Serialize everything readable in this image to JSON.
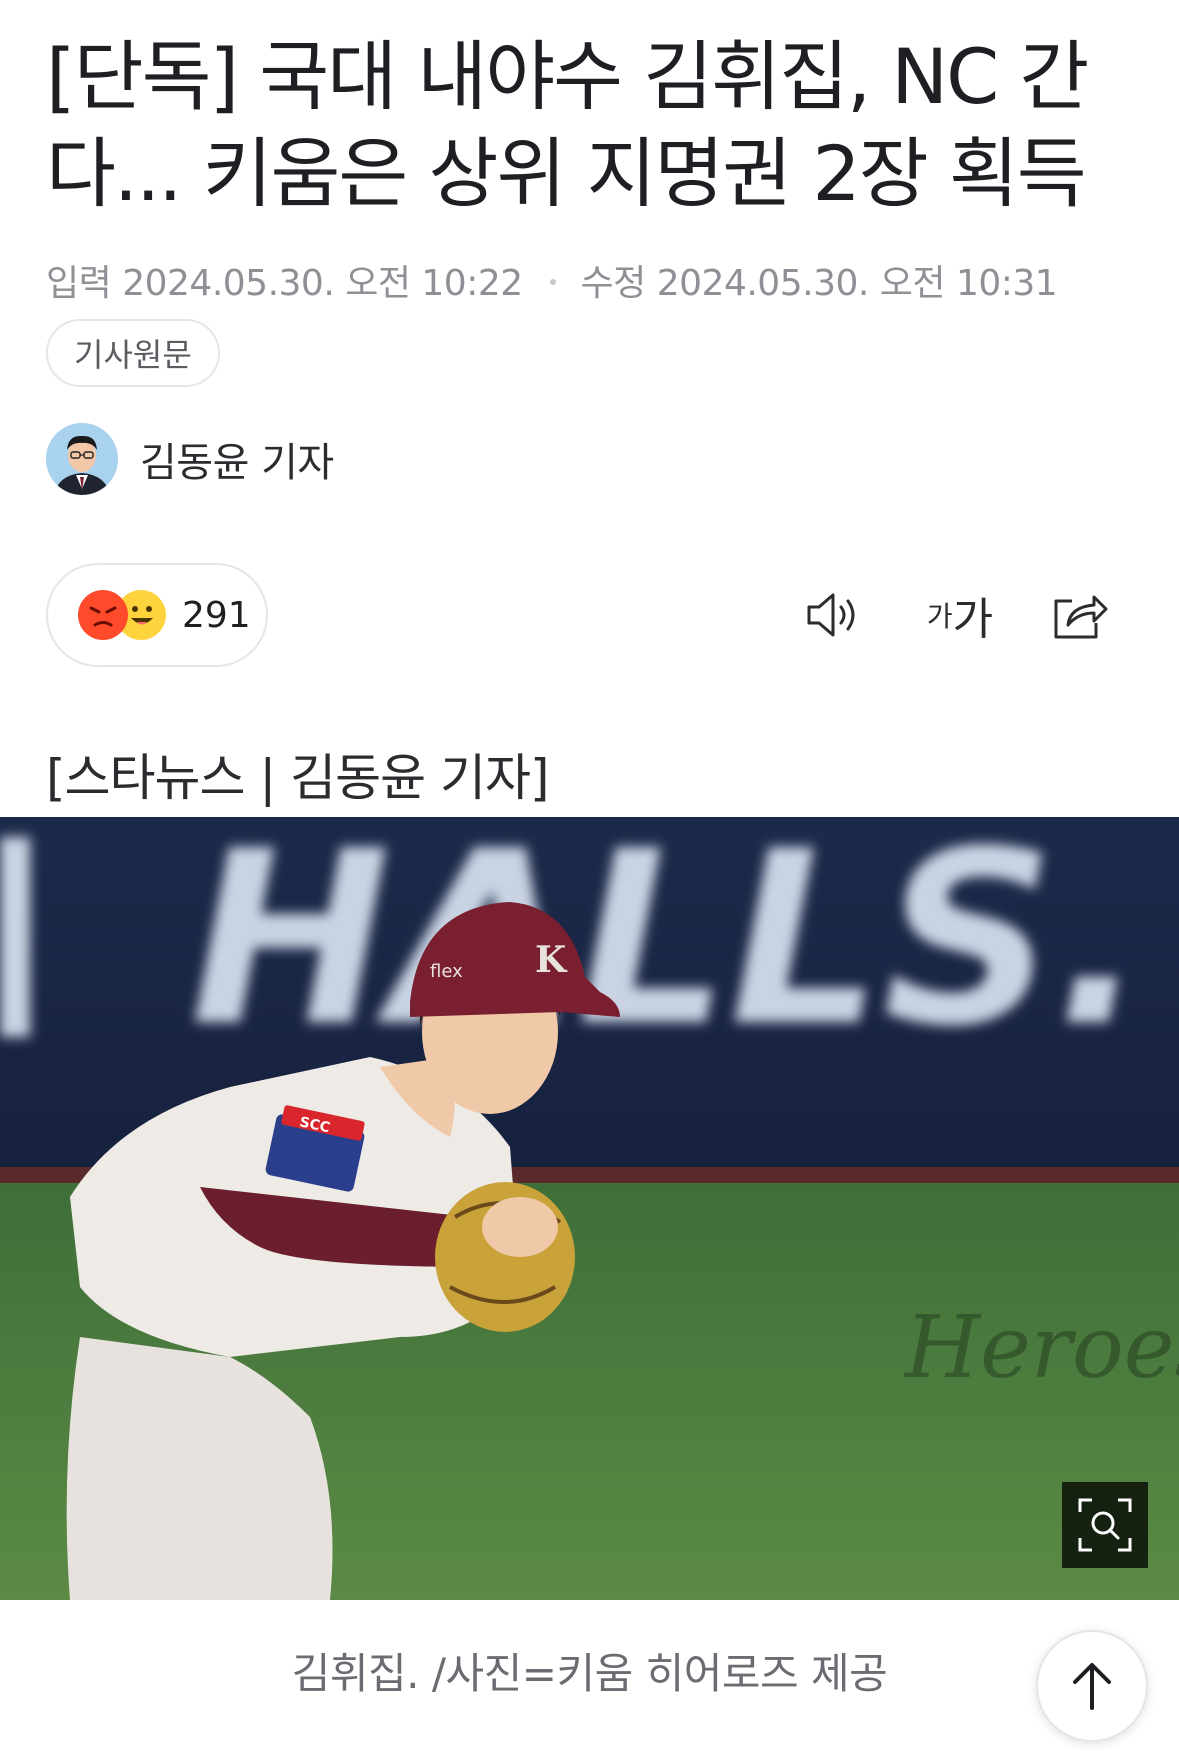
{
  "article": {
    "headline": "[단독] 국대 내야수 김휘집, NC 간다... 키움은 상위 지명권 2장 획득",
    "input_label": "입력",
    "input_time": "2024.05.30. 오전 10:22",
    "modified_label": "수정",
    "modified_time": "2024.05.30. 오전 10:31",
    "original_button": "기사원문",
    "author": "김동윤 기자",
    "source_line": "[스타뉴스 | 김동윤 기자]",
    "photo_caption": "김휘집. /사진=키움 히어로즈 제공"
  },
  "reactions": {
    "count": "291",
    "icons": [
      "angry-emoji",
      "happy-emoji"
    ]
  },
  "toolbar": {
    "font_size_label": "가가",
    "icons": [
      "speaker-icon",
      "font-size-icon",
      "share-icon"
    ]
  },
  "photo": {
    "banner_text": "HALLS.",
    "cap_logo": "K",
    "cap_sponsor": "flex",
    "patch_text": "SCC",
    "watermark": "Heroes"
  },
  "colors": {
    "text": "#1e1e23",
    "meta": "#8f8f96",
    "border": "#e5e5ea"
  }
}
